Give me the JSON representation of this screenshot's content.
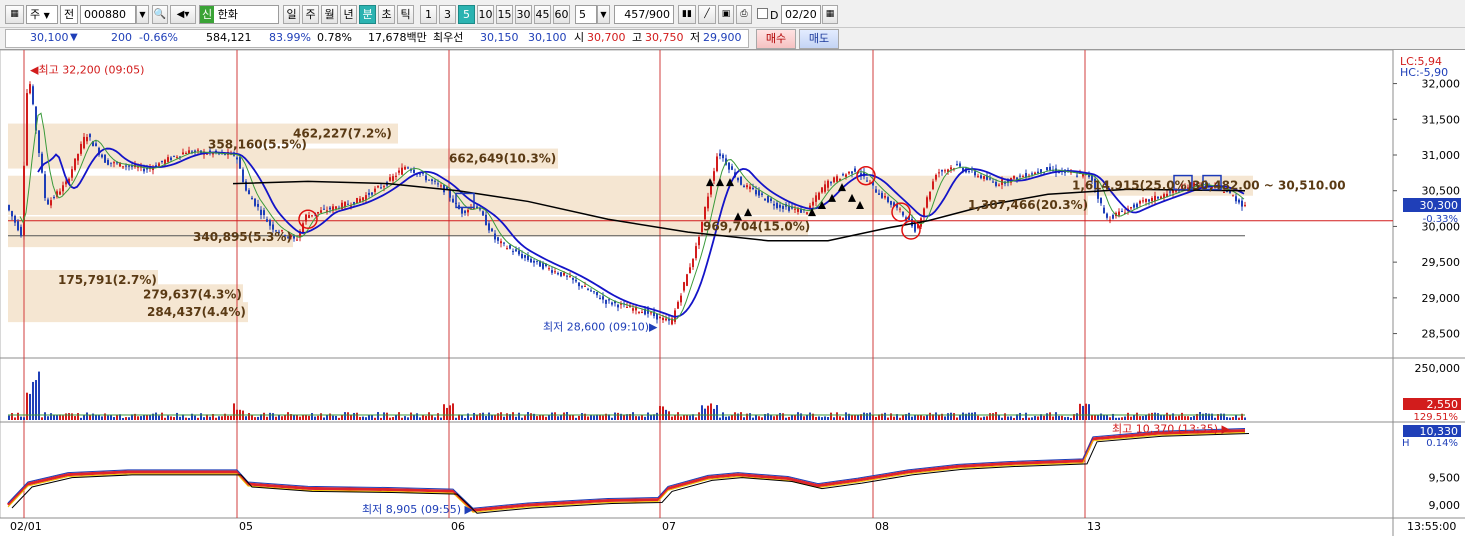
{
  "toolbar": {
    "market_label": "주",
    "type_label": "전",
    "code": "000880",
    "stock_badge": "신",
    "stock_name": "한화",
    "period_buttons": [
      "일",
      "주",
      "월",
      "년",
      "분",
      "초",
      "틱"
    ],
    "active_period": "분",
    "minute_buttons": [
      "1",
      "3",
      "5",
      "10",
      "15",
      "30",
      "45",
      "60"
    ],
    "active_minute": "5",
    "interval_value": "5",
    "count_value": "457",
    "count_total": "/900",
    "checkbox_d_label": "D",
    "date_value": "02/20"
  },
  "quote": {
    "price": "30,100",
    "change": "200",
    "change_pct": "-0.66%",
    "volume": "584,121",
    "ratio1": "83.99%",
    "ratio2": "0.78%",
    "amount": "17,678백만",
    "best_ask_label": "최우선",
    "best_ask": "30,150",
    "best_bid": "30,100",
    "open_label": "시",
    "open": "30,700",
    "high_label": "고",
    "high": "30,750",
    "low_label": "저",
    "low": "29,900",
    "buy_button": "매수",
    "sell_button": "매도"
  },
  "price_panel": {
    "y_axis": [
      "32,000",
      "31,500",
      "31,000",
      "30,500",
      "30,000",
      "29,500",
      "29,000",
      "28,500"
    ],
    "ylim": [
      28200,
      32400
    ],
    "lc": "LC:5,94",
    "hc": "HC:-5,90",
    "current_price": "30,300",
    "current_pct": "-0.33%",
    "high_note": "최고 32,200 (09:05)",
    "low_note": "최저 28,600 (09:10)",
    "volume_profile": [
      {
        "text": "462,227(7.2%)",
        "price": 31300,
        "len": 390
      },
      {
        "text": "358,160(5.5%)",
        "price": 31150,
        "len": 240
      },
      {
        "text": "662,649(10.3%)",
        "price": 30950,
        "len": 550
      },
      {
        "text": "340,895(5.3%)",
        "price": 29850,
        "len": 285
      },
      {
        "text": "175,791(2.7%)",
        "price": 29250,
        "len": 150
      },
      {
        "text": "279,637(4.3%)",
        "price": 29050,
        "len": 235
      },
      {
        "text": "284,437(4.4%)",
        "price": 28800,
        "len": 240
      },
      {
        "text": "969,704(15.0%)",
        "price": 30000,
        "len": 800
      },
      {
        "text": "1,307,466(20.3%)",
        "price": 30300,
        "len": 1080
      },
      {
        "text": "1,614,915(25.0%)",
        "price": 30570,
        "len": 1245
      }
    ],
    "range_note": "30,482.00 ~ 30,510.00"
  },
  "volume_panel": {
    "y_axis": [
      "250,000"
    ],
    "current": "2,550",
    "current_pct": "129.51%"
  },
  "obv_panel": {
    "y_axis": [
      "9,500",
      "9,000"
    ],
    "current": "10,330",
    "current_pct": "0.14%",
    "label_h": "H",
    "high_note": "최고 10,370 (13:35)",
    "low_note": "최저 8,905 (09:55)"
  },
  "x_axis": [
    "02/01",
    "05",
    "06",
    "07",
    "08",
    "13"
  ],
  "time_label": "13:55:00",
  "colors": {
    "up": "#d21c1c",
    "down": "#1f3fb8",
    "ma": "#1414c8",
    "ma_long": "#000000",
    "profile": "#f5e6d2",
    "divider": "#d23c3c"
  }
}
